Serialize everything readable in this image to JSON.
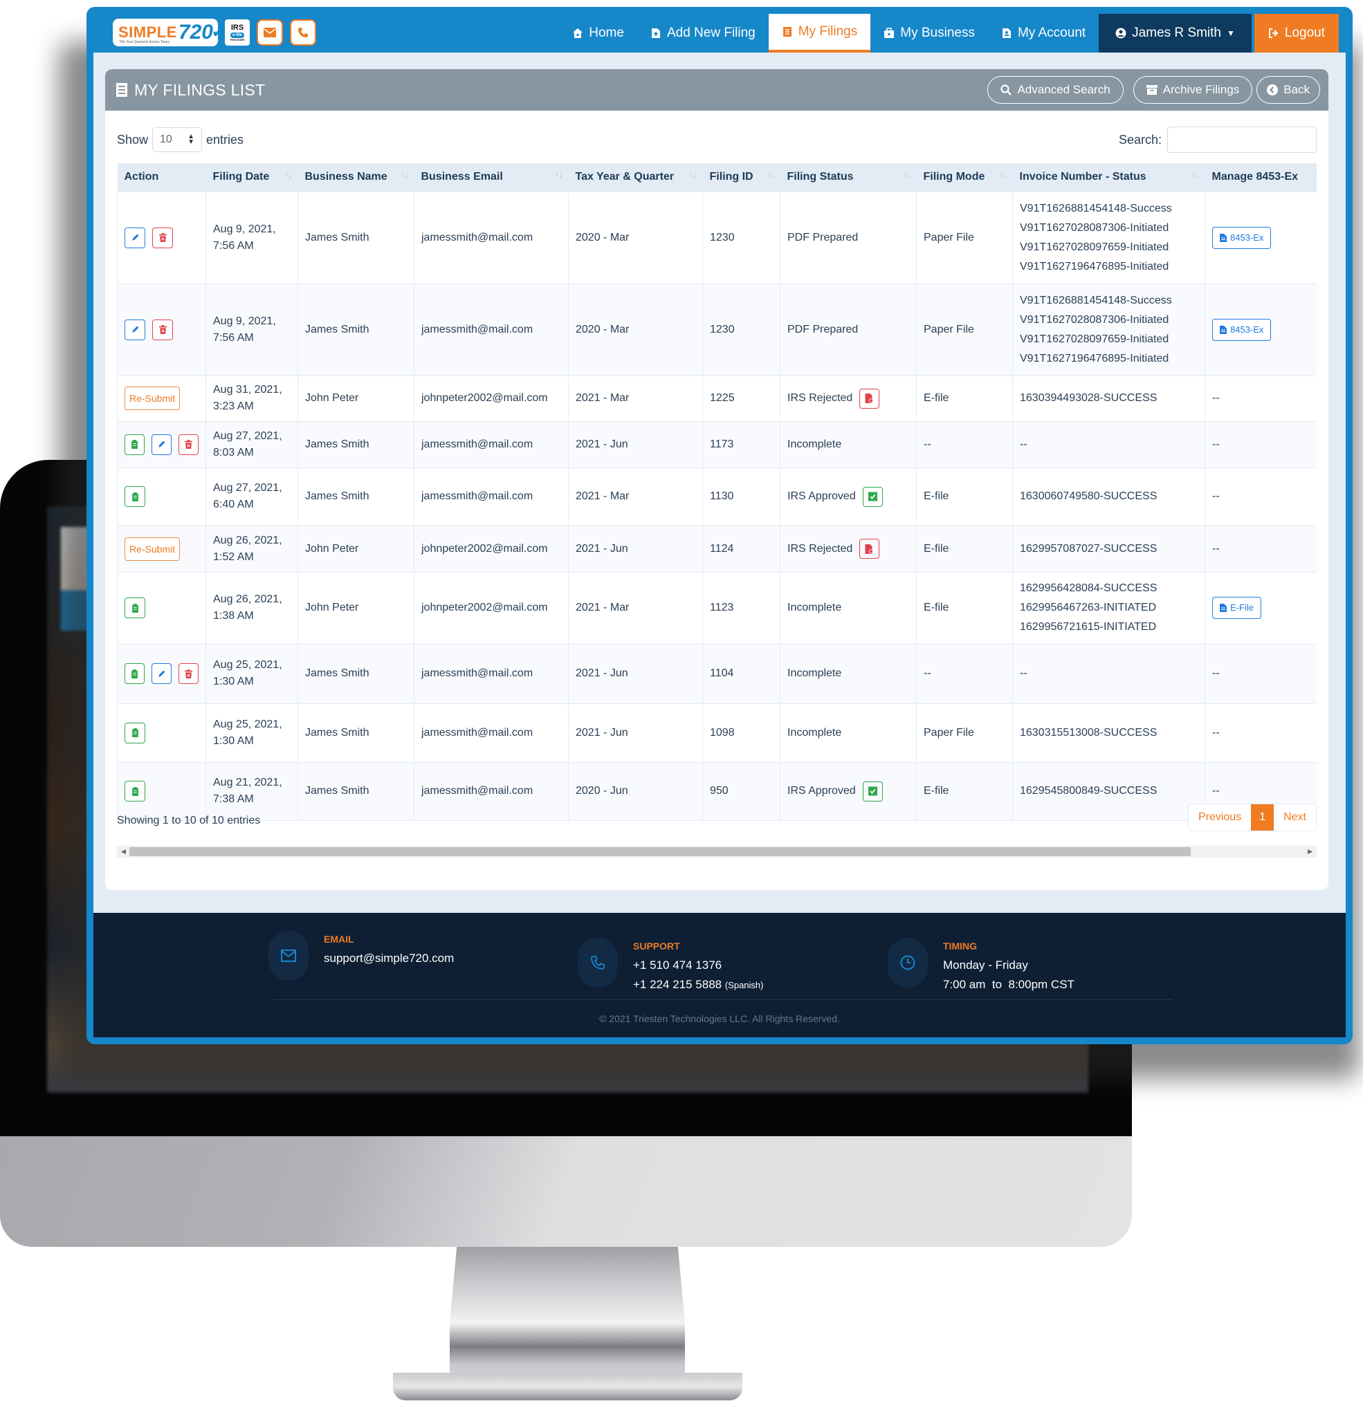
{
  "nav": {
    "logo_text": "SIMPLE",
    "logo_number": "720",
    "logo_tagline": "File Your Quarterly Excise Taxes",
    "irs_badge": {
      "top": "IRS",
      "middle": "e-file",
      "bottom": "PROVIDER"
    },
    "contact_icons": [
      "envelope-icon",
      "phone-icon"
    ],
    "items": [
      {
        "label": "Home",
        "icon": "home-icon",
        "active": false
      },
      {
        "label": "Add New Filing",
        "icon": "file-plus-icon",
        "active": false
      },
      {
        "label": "My Filings",
        "icon": "list-icon",
        "active": true
      },
      {
        "label": "My Business",
        "icon": "briefcase-icon",
        "active": false
      },
      {
        "label": "My Account",
        "icon": "account-icon",
        "active": false
      }
    ],
    "user": {
      "label": "James R Smith",
      "icon": "user-circle-icon"
    },
    "logout": {
      "label": "Logout",
      "icon": "sign-out-icon"
    }
  },
  "panel": {
    "title": "MY FILINGS LIST",
    "buttons": {
      "advanced_search": "Advanced Search",
      "archive": "Archive Filings",
      "back": "Back"
    },
    "show_label": "Show",
    "entries_label": "entries",
    "page_length": "10",
    "search_label": "Search:",
    "search_value": ""
  },
  "table": {
    "columns": [
      "Action",
      "Filing Date",
      "Business Name",
      "Business Email",
      "Tax Year & Quarter",
      "Filing ID",
      "Filing Status",
      "Filing Mode",
      "Invoice Number - Status",
      "Manage 8453-Ex"
    ],
    "rows": [
      {
        "actions": [
          "edit",
          "delete"
        ],
        "date_line1": "Aug 9, 2021,",
        "date_line2": "7:56 AM",
        "business": "James Smith",
        "email": "jamessmith@mail.com",
        "tax_period": "2020 - Mar",
        "filing_id": "1230",
        "status": "PDF Prepared",
        "status_icon": "",
        "mode": "Paper File",
        "invoices": [
          "V91T1626881454148-Success",
          "V91T1627028087306-Initiated",
          "V91T1627028097659-Initiated",
          "V91T1627196476895-Initiated"
        ],
        "manage": {
          "type": "button",
          "label": "8453-Ex"
        }
      },
      {
        "actions": [
          "edit",
          "delete"
        ],
        "date_line1": "Aug 9, 2021,",
        "date_line2": "7:56 AM",
        "business": "James Smith",
        "email": "jamessmith@mail.com",
        "tax_period": "2020 - Mar",
        "filing_id": "1230",
        "status": "PDF Prepared",
        "status_icon": "",
        "mode": "Paper File",
        "invoices": [
          "V91T1626881454148-Success",
          "V91T1627028087306-Initiated",
          "V91T1627028097659-Initiated",
          "V91T1627196476895-Initiated"
        ],
        "manage": {
          "type": "button",
          "label": "8453-Ex"
        }
      },
      {
        "actions": [
          "resubmit"
        ],
        "resubmit_label": "Re-Submit",
        "date_line1": "Aug 31, 2021,",
        "date_line2": "3:23 AM",
        "business": "John Peter",
        "email": "johnpeter2002@mail.com",
        "tax_period": "2021 - Mar",
        "filing_id": "1225",
        "status": "IRS Rejected",
        "status_icon": "rejected",
        "mode": "E-file",
        "invoices": [
          "1630394493028-SUCCESS"
        ],
        "manage": {
          "type": "text",
          "label": "--"
        }
      },
      {
        "actions": [
          "clipboard",
          "edit",
          "delete"
        ],
        "date_line1": "Aug 27, 2021,",
        "date_line2": "8:03 AM",
        "business": "James Smith",
        "email": "jamessmith@mail.com",
        "tax_period": "2021 - Jun",
        "filing_id": "1173",
        "status": "Incomplete",
        "status_icon": "",
        "mode": "--",
        "invoices": [
          "--"
        ],
        "manage": {
          "type": "text",
          "label": "--"
        }
      },
      {
        "actions": [
          "clipboard"
        ],
        "date_line1": "Aug 27, 2021,",
        "date_line2": "6:40 AM",
        "business": "James Smith",
        "email": "jamessmith@mail.com",
        "tax_period": "2021 - Mar",
        "filing_id": "1130",
        "status": "IRS Approved",
        "status_icon": "approved",
        "mode": "E-file",
        "invoices": [
          "1630060749580-SUCCESS"
        ],
        "manage": {
          "type": "text",
          "label": "--"
        }
      },
      {
        "actions": [
          "resubmit"
        ],
        "resubmit_label": "Re-Submit",
        "date_line1": "Aug 26, 2021,",
        "date_line2": "1:52 AM",
        "business": "John Peter",
        "email": "johnpeter2002@mail.com",
        "tax_period": "2021 - Jun",
        "filing_id": "1124",
        "status": "IRS Rejected",
        "status_icon": "rejected",
        "mode": "E-file",
        "invoices": [
          "1629957087027-SUCCESS"
        ],
        "manage": {
          "type": "text",
          "label": "--"
        }
      },
      {
        "actions": [
          "clipboard"
        ],
        "date_line1": "Aug 26, 2021,",
        "date_line2": "1:38 AM",
        "business": "John Peter",
        "email": "johnpeter2002@mail.com",
        "tax_period": "2021 - Mar",
        "filing_id": "1123",
        "status": "Incomplete",
        "status_icon": "",
        "mode": "E-file",
        "invoices": [
          "1629956428084-SUCCESS",
          "1629956467263-INITIATED",
          "1629956721615-INITIATED"
        ],
        "manage": {
          "type": "button",
          "label": "E-File"
        }
      },
      {
        "actions": [
          "clipboard",
          "edit",
          "delete"
        ],
        "date_line1": "Aug 25, 2021,",
        "date_line2": "1:30 AM",
        "business": "James Smith",
        "email": "jamessmith@mail.com",
        "tax_period": "2021 - Jun",
        "filing_id": "1104",
        "status": "Incomplete",
        "status_icon": "",
        "mode": "--",
        "invoices": [
          "--"
        ],
        "manage": {
          "type": "text",
          "label": "--"
        }
      },
      {
        "actions": [
          "clipboard"
        ],
        "date_line1": "Aug 25, 2021,",
        "date_line2": "1:30 AM",
        "business": "James Smith",
        "email": "jamessmith@mail.com",
        "tax_period": "2021 - Jun",
        "filing_id": "1098",
        "status": "Incomplete",
        "status_icon": "",
        "mode": "Paper File",
        "invoices": [
          "1630315513008-SUCCESS"
        ],
        "manage": {
          "type": "text",
          "label": "--"
        }
      },
      {
        "actions": [
          "clipboard"
        ],
        "date_line1": "Aug 21, 2021,",
        "date_line2": "7:38 AM",
        "business": "James Smith",
        "email": "jamessmith@mail.com",
        "tax_period": "2020 - Jun",
        "filing_id": "950",
        "status": "IRS Approved",
        "status_icon": "approved",
        "mode": "E-file",
        "invoices": [
          "1629545800849-SUCCESS"
        ],
        "manage": {
          "type": "text",
          "label": "--"
        }
      }
    ],
    "info": "Showing 1 to 10 of 10 entries",
    "pagination": {
      "previous": "Previous",
      "current": "1",
      "next": "Next"
    }
  },
  "footer": {
    "email": {
      "label": "EMAIL",
      "value": "support@simple720.com"
    },
    "support": {
      "label": "SUPPORT",
      "phone1": "+1 510 474 1376",
      "phone2": "+1 224 215 5888",
      "phone2_note": "(Spanish)"
    },
    "timing": {
      "label": "TIMING",
      "days": "Monday - Friday",
      "hours": "7:00 am  to  8:00pm CST"
    },
    "copyright": "2021 Triesten Technologies LLC. All Rights Reserved."
  },
  "colors": {
    "brand_blue": "#1687c9",
    "brand_orange": "#ef7b23",
    "nav_user_bg": "#0d3a5e",
    "panel_header": "#8896a1",
    "footer_bg": "#0e1f34",
    "approved": "#2ca84a",
    "rejected": "#e0424a",
    "edit": "#1f7ae0"
  }
}
